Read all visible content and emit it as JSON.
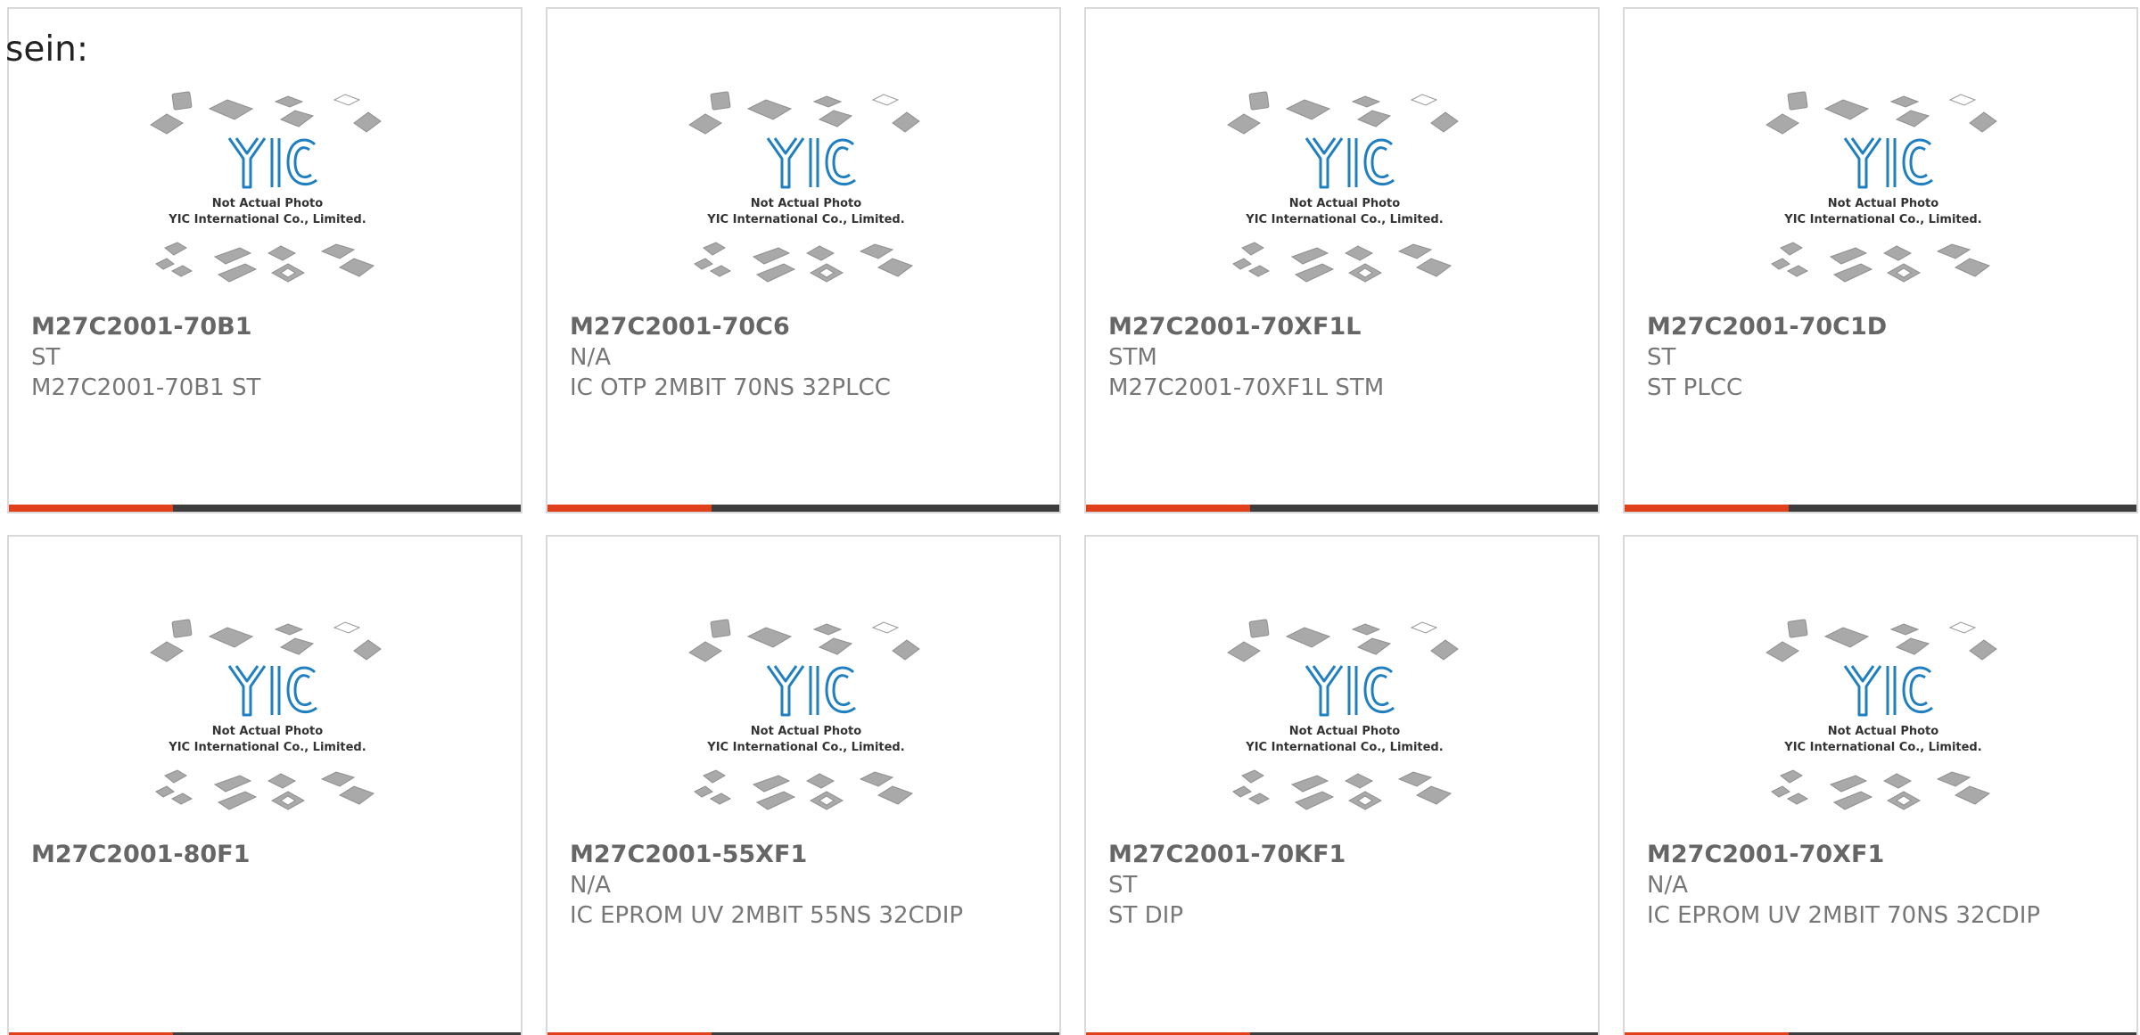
{
  "heading": "sein:",
  "placeholder": {
    "line1": "Not Actual Photo",
    "line2": "YIC International Co., Limited.",
    "logo": "YIC"
  },
  "colors": {
    "accent": "#e0401b",
    "bar": "#3d3d3d",
    "logo_blue": "#1f7fc0",
    "chip_gray": "#a9a9a9"
  },
  "products": [
    {
      "part": "M27C2001-70B1",
      "maker": "ST",
      "desc": "M27C2001-70B1 ST"
    },
    {
      "part": "M27C2001-70C6",
      "maker": "N/A",
      "desc": "IC OTP 2MBIT 70NS 32PLCC"
    },
    {
      "part": "M27C2001-70XF1L",
      "maker": "STM",
      "desc": "M27C2001-70XF1L STM"
    },
    {
      "part": "M27C2001-70C1D",
      "maker": "ST",
      "desc": "ST PLCC"
    },
    {
      "part": "M27C2001-80F1",
      "maker": "",
      "desc": ""
    },
    {
      "part": "M27C2001-55XF1",
      "maker": "N/A",
      "desc": "IC EPROM UV 2MBIT 55NS 32CDIP"
    },
    {
      "part": "M27C2001-70KF1",
      "maker": "ST",
      "desc": "ST DIP"
    },
    {
      "part": "M27C2001-70XF1",
      "maker": "N/A",
      "desc": "IC EPROM UV 2MBIT 70NS 32CDIP"
    }
  ]
}
